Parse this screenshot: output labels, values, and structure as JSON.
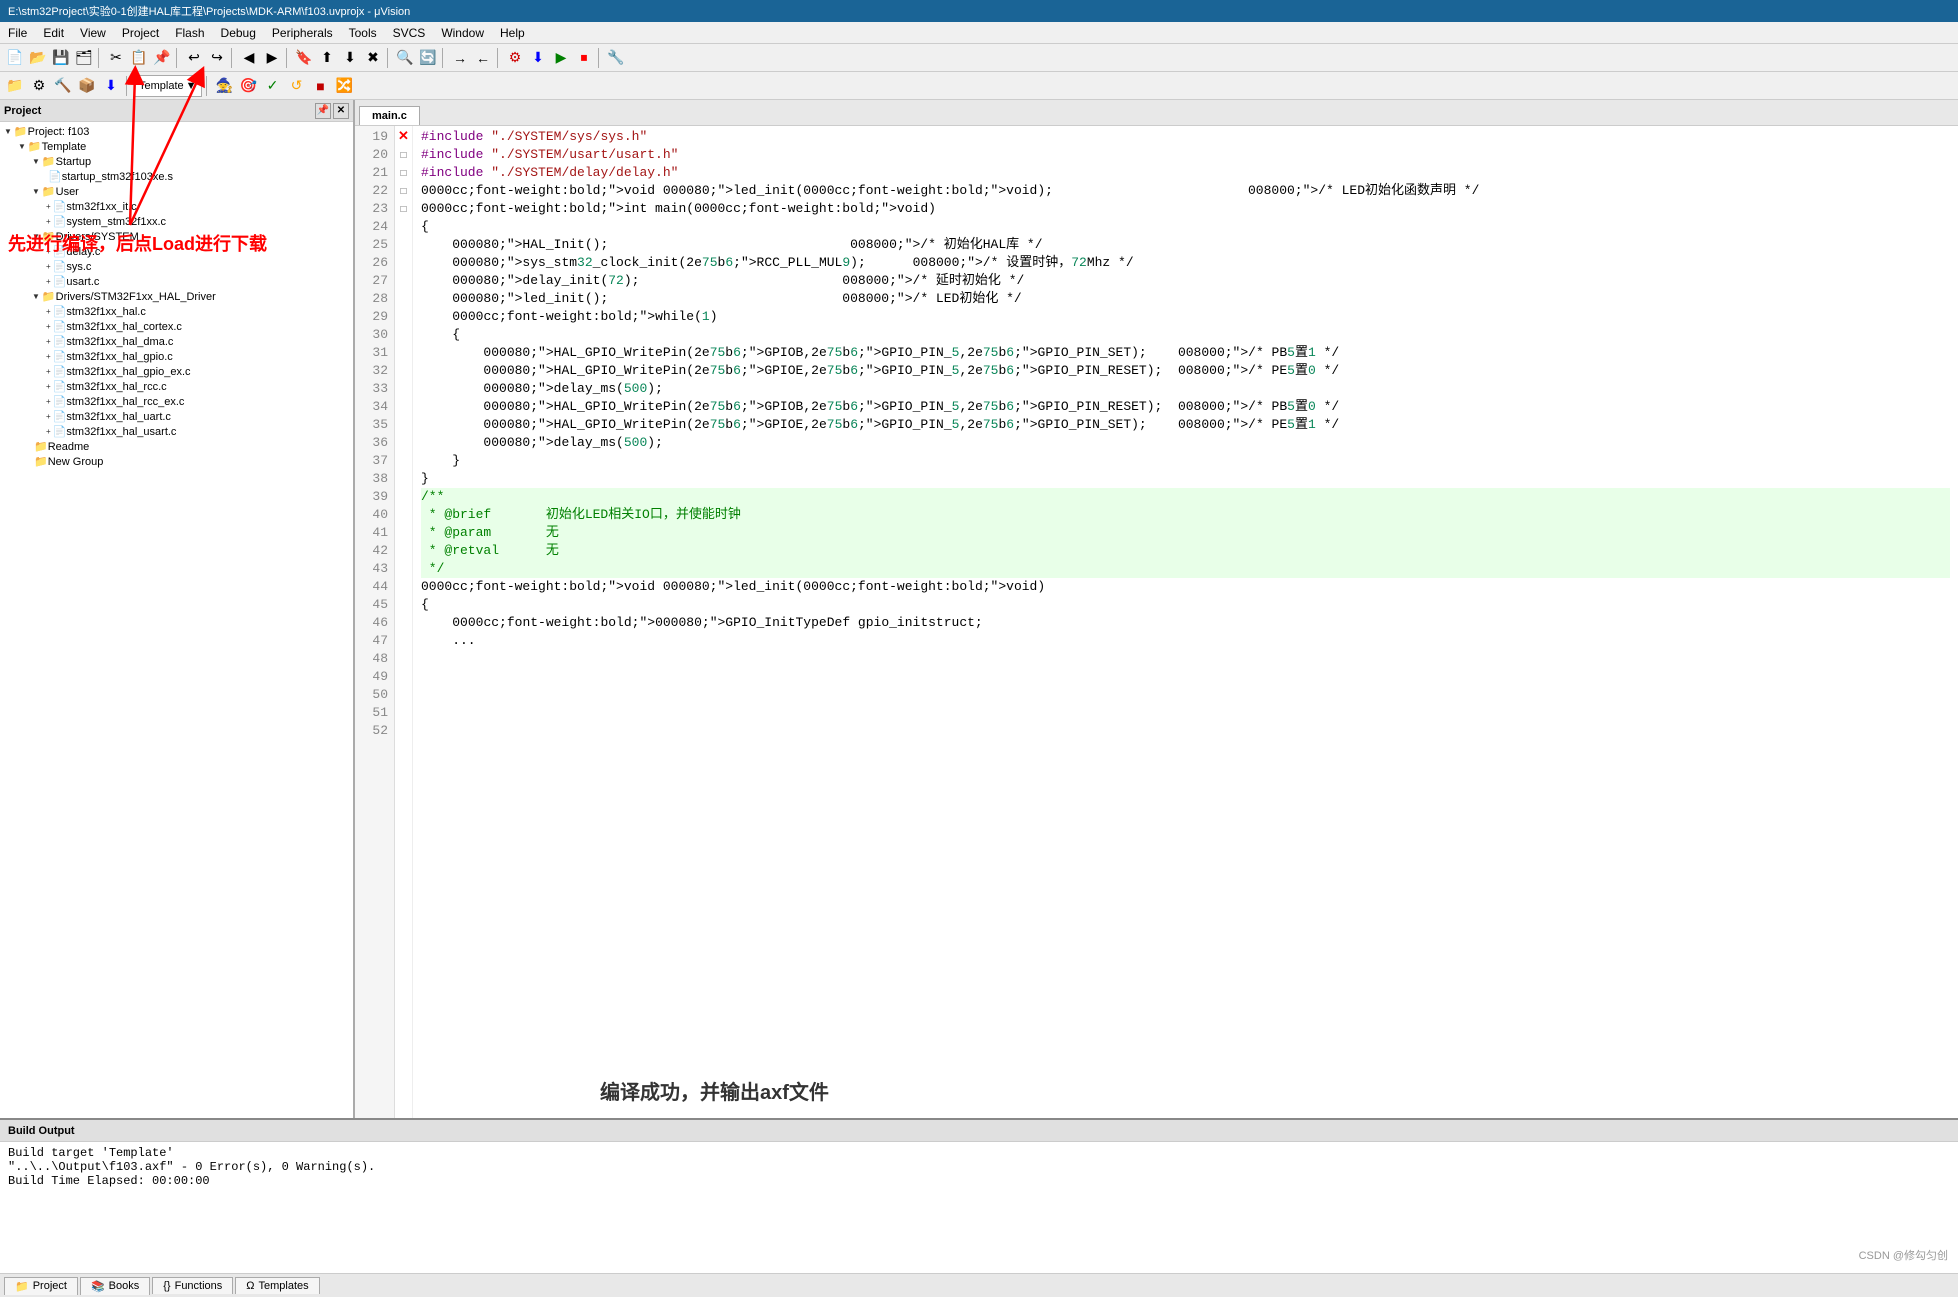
{
  "titleBar": {
    "text": "E:\\stm32Project\\实验0-1创建HAL库工程\\Projects\\MDK-ARM\\f103.uvprojx - μVision"
  },
  "menuBar": {
    "items": [
      "File",
      "Edit",
      "View",
      "Project",
      "Flash",
      "Debug",
      "Peripherals",
      "Tools",
      "SVCS",
      "Window",
      "Help"
    ]
  },
  "toolbar2": {
    "templateLabel": "Template",
    "dropdownArrow": "▼"
  },
  "projectPanel": {
    "title": "Project",
    "tree": [
      {
        "level": 0,
        "expand": "▼",
        "icon": "folder",
        "label": "Project: f103"
      },
      {
        "level": 1,
        "expand": "▼",
        "icon": "folder",
        "label": "Template"
      },
      {
        "level": 2,
        "expand": "▼",
        "icon": "folder",
        "label": "Startup"
      },
      {
        "level": 3,
        "expand": "",
        "icon": "file",
        "label": "startup_stm32f103xe.s"
      },
      {
        "level": 2,
        "expand": "▼",
        "icon": "folder",
        "label": "User"
      },
      {
        "level": 3,
        "expand": "+",
        "icon": "file",
        "label": "stm32f1xx_it.c"
      },
      {
        "level": 3,
        "expand": "+",
        "icon": "file",
        "label": "system_stm32f1xx.c"
      },
      {
        "level": 2,
        "expand": "▼",
        "icon": "folder",
        "label": "Drivers/SYSTEM"
      },
      {
        "level": 3,
        "expand": "+",
        "icon": "file",
        "label": "delay.c"
      },
      {
        "level": 3,
        "expand": "+",
        "icon": "file",
        "label": "sys.c"
      },
      {
        "level": 3,
        "expand": "+",
        "icon": "file",
        "label": "usart.c"
      },
      {
        "level": 2,
        "expand": "▼",
        "icon": "folder",
        "label": "Drivers/STM32F1xx_HAL_Driver"
      },
      {
        "level": 3,
        "expand": "+",
        "icon": "file",
        "label": "stm32f1xx_hal.c"
      },
      {
        "level": 3,
        "expand": "+",
        "icon": "file",
        "label": "stm32f1xx_hal_cortex.c"
      },
      {
        "level": 3,
        "expand": "+",
        "icon": "file",
        "label": "stm32f1xx_hal_dma.c"
      },
      {
        "level": 3,
        "expand": "+",
        "icon": "file",
        "label": "stm32f1xx_hal_gpio.c"
      },
      {
        "level": 3,
        "expand": "+",
        "icon": "file",
        "label": "stm32f1xx_hal_gpio_ex.c"
      },
      {
        "level": 3,
        "expand": "+",
        "icon": "file",
        "label": "stm32f1xx_hal_rcc.c"
      },
      {
        "level": 3,
        "expand": "+",
        "icon": "file",
        "label": "stm32f1xx_hal_rcc_ex.c"
      },
      {
        "level": 3,
        "expand": "+",
        "icon": "file",
        "label": "stm32f1xx_hal_uart.c"
      },
      {
        "level": 3,
        "expand": "+",
        "icon": "file",
        "label": "stm32f1xx_hal_usart.c"
      },
      {
        "level": 2,
        "expand": "",
        "icon": "folder",
        "label": "Readme"
      },
      {
        "level": 2,
        "expand": "",
        "icon": "folder",
        "label": "New Group"
      }
    ]
  },
  "codeTab": {
    "filename": "main.c"
  },
  "codeLines": [
    {
      "num": 19,
      "marker": "",
      "text": ""
    },
    {
      "num": 20,
      "marker": "",
      "text": "#include \"./SYSTEM/sys/sys.h\""
    },
    {
      "num": 21,
      "marker": "",
      "text": "#include \"./SYSTEM/usart/usart.h\""
    },
    {
      "num": 22,
      "marker": "",
      "text": "#include \"./SYSTEM/delay/delay.h\""
    },
    {
      "num": 23,
      "marker": "",
      "text": ""
    },
    {
      "num": 24,
      "marker": "",
      "text": "void led_init(void);                         /* LED初始化函数声明 */"
    },
    {
      "num": 25,
      "marker": "",
      "text": ""
    },
    {
      "num": 26,
      "marker": "",
      "text": "int main(void)"
    },
    {
      "num": 27,
      "marker": "□",
      "text": "{"
    },
    {
      "num": 28,
      "marker": "",
      "text": "    HAL_Init();                               /* 初始化HAL库 */"
    },
    {
      "num": 29,
      "marker": "",
      "text": "    sys_stm32_clock_init(RCC_PLL_MUL9);      /* 设置时钟，72Mhz */"
    },
    {
      "num": 30,
      "marker": "",
      "text": "    delay_init(72);                          /* 延时初始化 */"
    },
    {
      "num": 31,
      "marker": "",
      "text": "    led_init();                              /* LED初始化 */"
    },
    {
      "num": 32,
      "marker": "",
      "text": ""
    },
    {
      "num": 33,
      "marker": "",
      "text": "    while(1)"
    },
    {
      "num": 34,
      "marker": "□",
      "text": "    {"
    },
    {
      "num": 35,
      "marker": "",
      "text": "        HAL_GPIO_WritePin(GPIOB,GPIO_PIN_5,GPIO_PIN_SET);    /* PB5置1 */"
    },
    {
      "num": 36,
      "marker": "",
      "text": "        HAL_GPIO_WritePin(GPIOE,GPIO_PIN_5,GPIO_PIN_RESET);  /* PE5置0 */"
    },
    {
      "num": 37,
      "marker": "",
      "text": "        delay_ms(500);"
    },
    {
      "num": 38,
      "marker": "",
      "text": "        HAL_GPIO_WritePin(GPIOB,GPIO_PIN_5,GPIO_PIN_RESET);  /* PB5置0 */"
    },
    {
      "num": 39,
      "marker": "",
      "text": "        HAL_GPIO_WritePin(GPIOE,GPIO_PIN_5,GPIO_PIN_SET);    /* PE5置1 */"
    },
    {
      "num": 40,
      "marker": "",
      "text": "        delay_ms(500);"
    },
    {
      "num": 41,
      "marker": "",
      "text": "    }"
    },
    {
      "num": 42,
      "marker": "",
      "text": "}"
    },
    {
      "num": 43,
      "marker": "",
      "text": ""
    },
    {
      "num": 44,
      "marker": "□",
      "text": "/**",
      "highlight": true
    },
    {
      "num": 45,
      "marker": "",
      "text": " * @brief       初始化LED相关IO口，并使能时钟",
      "highlight": true
    },
    {
      "num": 46,
      "marker": "",
      "text": " * @param       无",
      "highlight": true
    },
    {
      "num": 47,
      "marker": "",
      "text": " * @retval      无",
      "highlight": true
    },
    {
      "num": 48,
      "marker": "",
      "text": " */",
      "highlight": true
    },
    {
      "num": 49,
      "marker": "",
      "text": "void led_init(void)"
    },
    {
      "num": 50,
      "marker": "□",
      "text": "{"
    },
    {
      "num": 51,
      "marker": "",
      "text": "    GPIO_InitTypeDef gpio_initstruct;"
    },
    {
      "num": 52,
      "marker": "",
      "text": "    ..."
    }
  ],
  "buildOutput": {
    "title": "Build Output",
    "lines": [
      "Build target 'Template'",
      "\"..\\..\\Output\\f103.axf\" - 0 Error(s), 0 Warning(s).",
      "Build Time Elapsed:  00:00:00"
    ]
  },
  "bottomTabs": [
    {
      "icon": "📁",
      "label": "Project"
    },
    {
      "icon": "📚",
      "label": "Books"
    },
    {
      "icon": "{}",
      "label": "Functions"
    },
    {
      "icon": "Ω",
      "label": "Templates"
    }
  ],
  "annotations": {
    "arrow1": "先进行编译，后点Load进行下载",
    "bottom": "编译成功，并输出axf文件"
  },
  "watermark": "CSDN @修勾匀创"
}
